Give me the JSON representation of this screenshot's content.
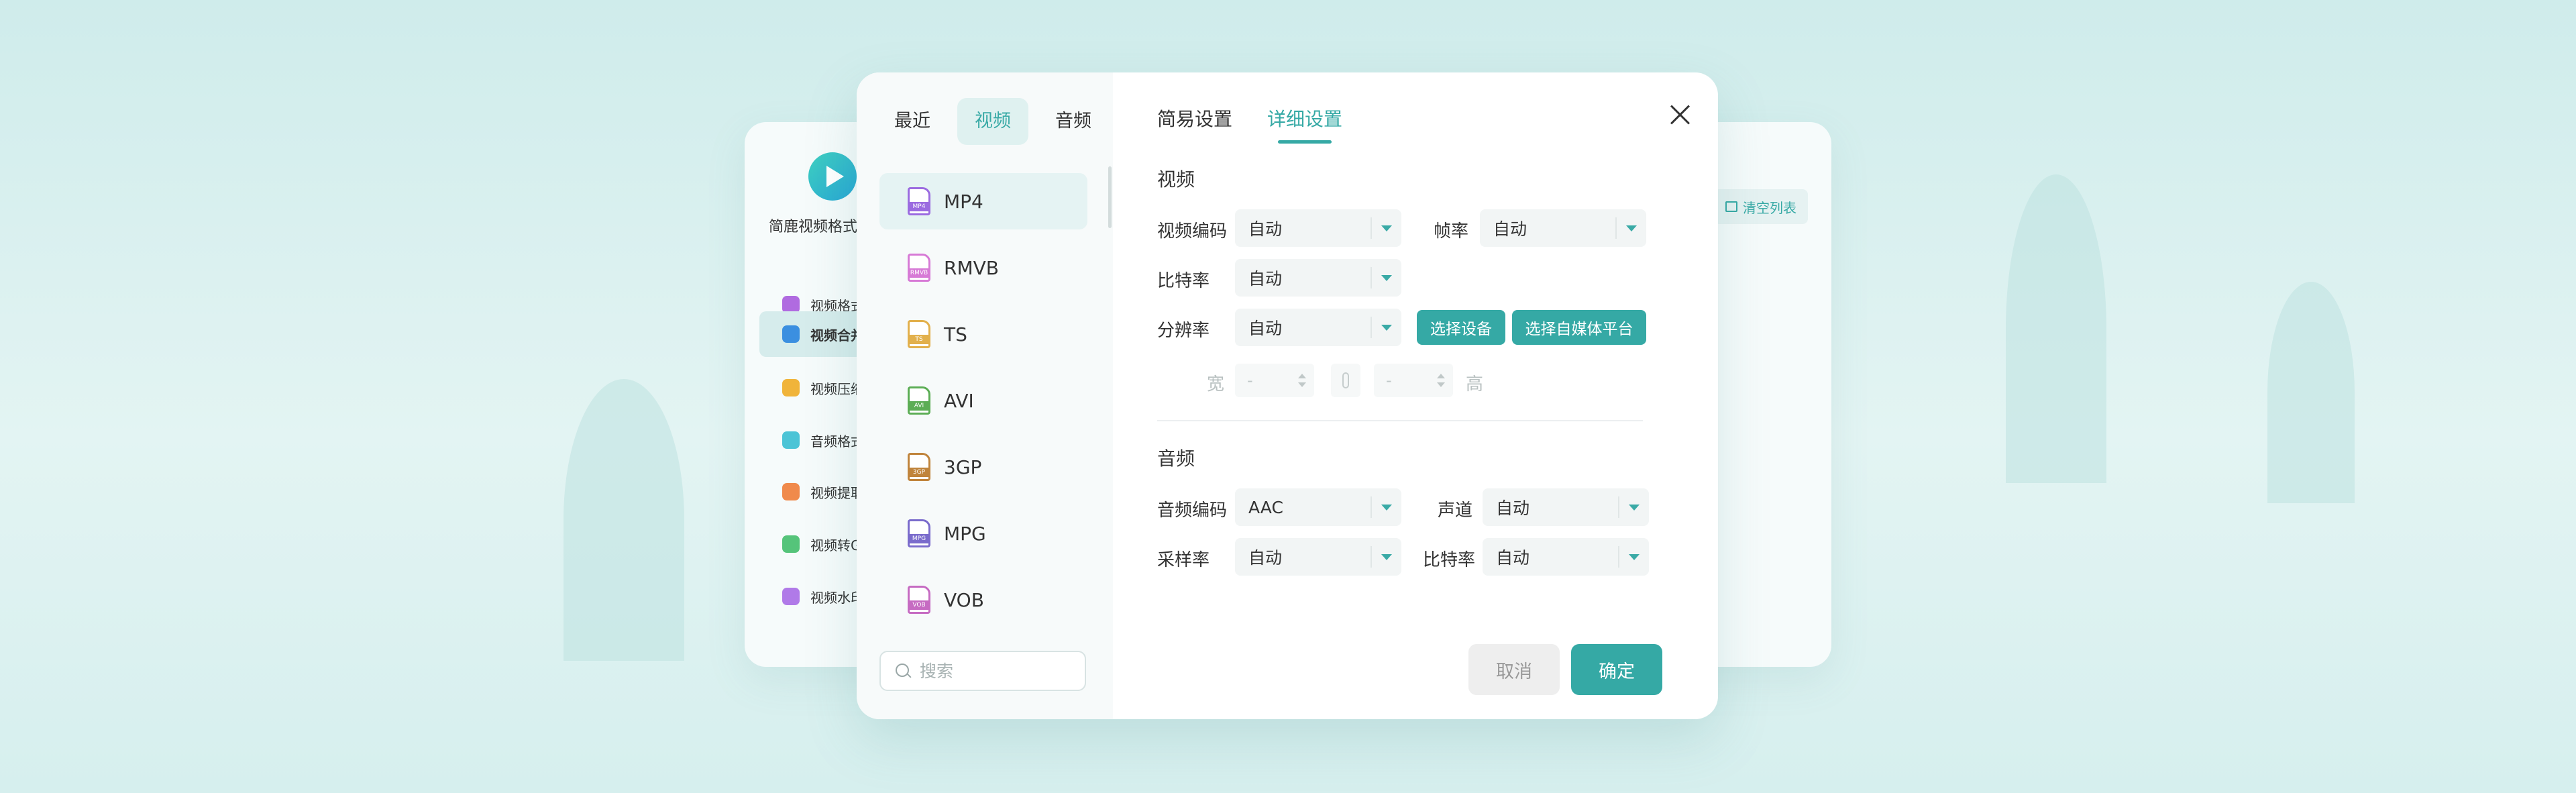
{
  "background_app": {
    "app_name": "简鹿视频格式",
    "clear_list_label": "清空列表",
    "nav_items": [
      {
        "label": "视频格式",
        "icon": "video-convert-icon",
        "color": "#b06be0"
      },
      {
        "label": "视频合并",
        "icon": "video-merge-icon",
        "color": "#3b8fe0"
      },
      {
        "label": "视频压缩",
        "icon": "video-compress-icon",
        "color": "#f0b43a"
      },
      {
        "label": "音频格式",
        "icon": "audio-convert-icon",
        "color": "#4cc4d6"
      },
      {
        "label": "视频提取",
        "icon": "video-extract-icon",
        "color": "#f08a4b"
      },
      {
        "label": "视频转G",
        "icon": "video-to-gif-icon",
        "color": "#55c47a"
      },
      {
        "label": "视频水印",
        "icon": "video-watermark-icon",
        "color": "#b07ae8"
      }
    ]
  },
  "dialog": {
    "category_tabs": [
      "最近",
      "视频",
      "音频"
    ],
    "active_category": "视频",
    "formats": [
      {
        "label": "MP4",
        "color": "#9b6be0",
        "active": true
      },
      {
        "label": "RMVB",
        "color": "#d77ad6",
        "active": false
      },
      {
        "label": "TS",
        "color": "#e2b04c",
        "active": false
      },
      {
        "label": "AVI",
        "color": "#5cad55",
        "active": false
      },
      {
        "label": "3GP",
        "color": "#c0843c",
        "active": false
      },
      {
        "label": "MPG",
        "color": "#7a6bcc",
        "active": false
      },
      {
        "label": "VOB",
        "color": "#c66bc2",
        "active": false
      }
    ],
    "search_placeholder": "搜索",
    "settings_tabs": [
      "简易设置",
      "详细设置"
    ],
    "active_settings_tab": "详细设置",
    "video_section": {
      "title": "视频",
      "codec_label": "视频编码",
      "codec_value": "自动",
      "framerate_label": "帧率",
      "framerate_value": "自动",
      "bitrate_label": "比特率",
      "bitrate_value": "自动",
      "resolution_label": "分辨率",
      "resolution_value": "自动",
      "select_device_label": "选择设备",
      "select_platform_label": "选择自媒体平台",
      "width_label": "宽",
      "width_value": "-",
      "height_label": "高",
      "height_value": "-"
    },
    "audio_section": {
      "title": "音频",
      "codec_label": "音频编码",
      "codec_value": "AAC",
      "channel_label": "声道",
      "channel_value": "自动",
      "samplerate_label": "采样率",
      "samplerate_value": "自动",
      "bitrate_label": "比特率",
      "bitrate_value": "自动"
    },
    "cancel_label": "取消",
    "confirm_label": "确定"
  }
}
